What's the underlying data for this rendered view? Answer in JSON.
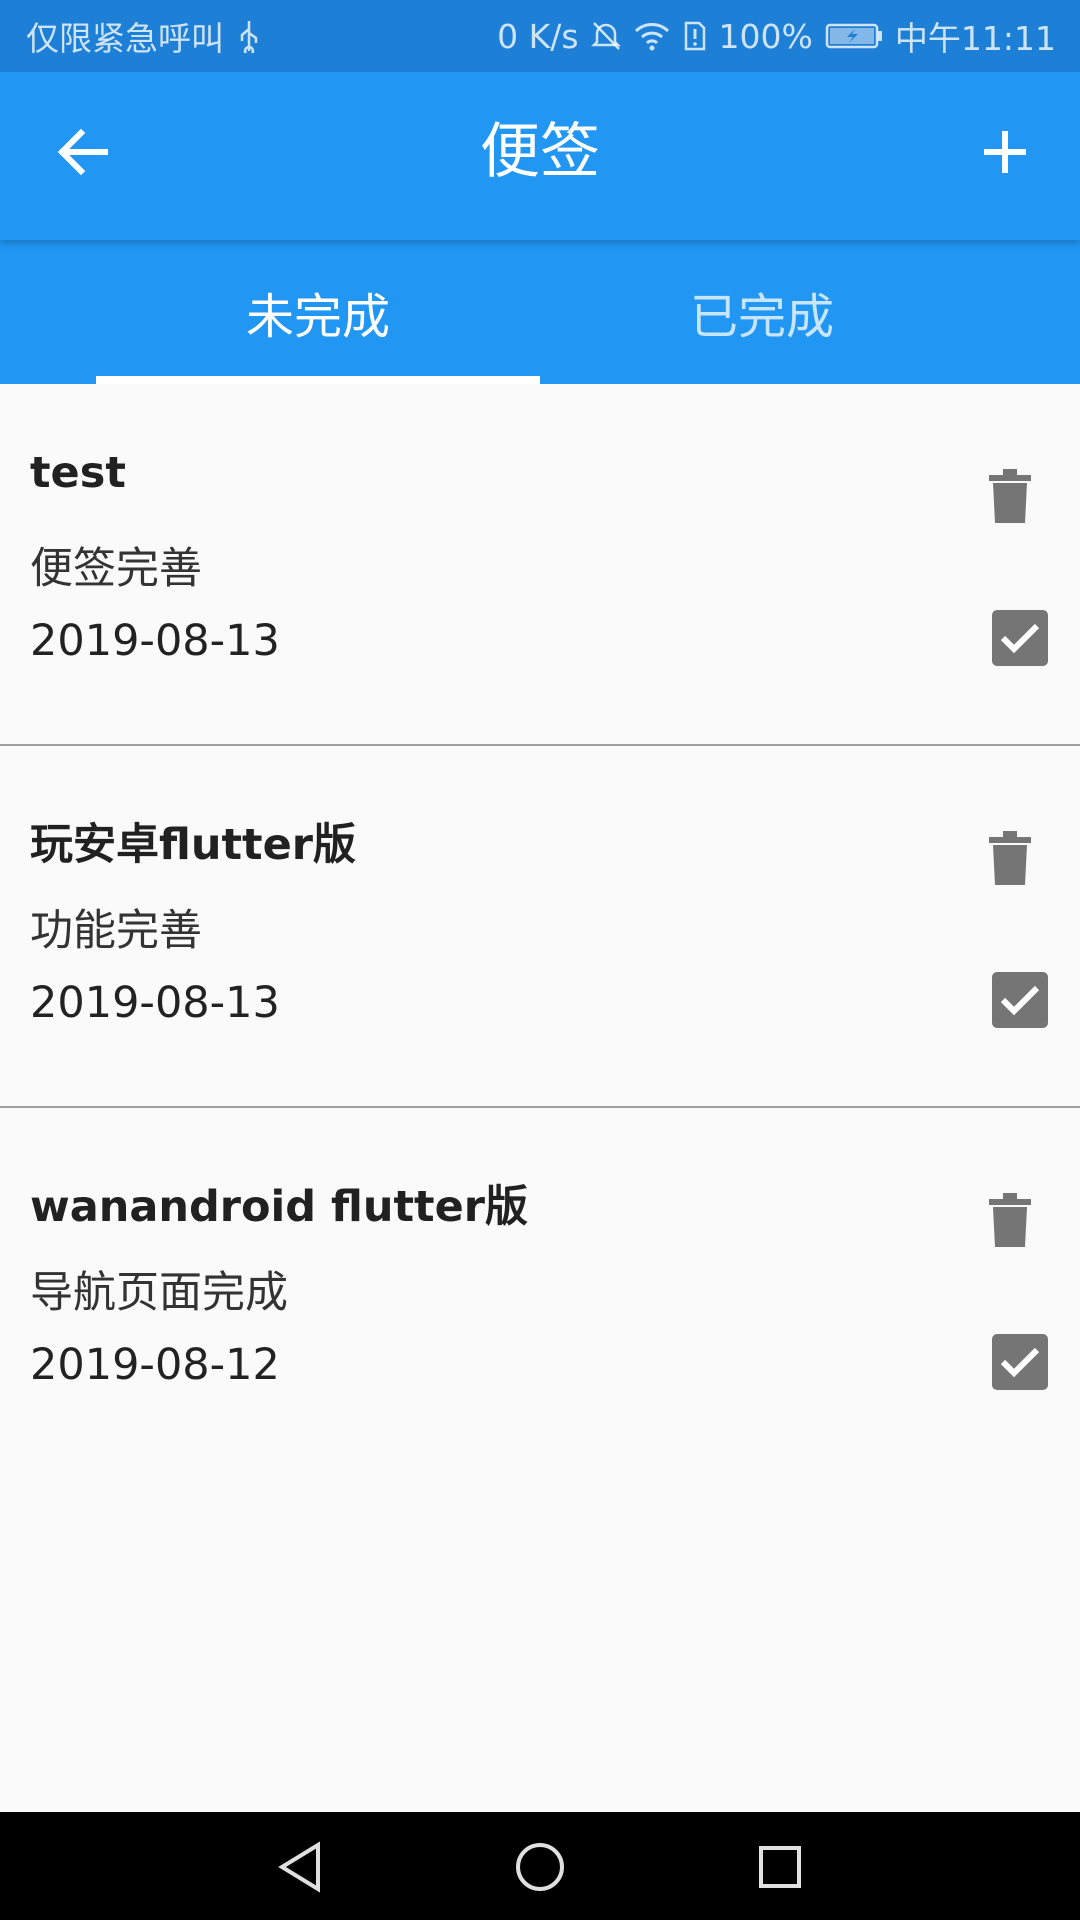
{
  "status_bar": {
    "carrier": "仅限紧急呼叫",
    "speed": "0 K/s",
    "battery": "100%",
    "time": "中午11:11"
  },
  "app_bar": {
    "title": "便签",
    "back_icon": "arrow-left-icon",
    "add_icon": "plus-icon"
  },
  "tabs": [
    {
      "label": "未完成",
      "active": true
    },
    {
      "label": "已完成",
      "active": false
    }
  ],
  "notes": [
    {
      "title": "test",
      "content": "便签完善",
      "date": "2019-08-13",
      "done": true
    },
    {
      "title": "玩安卓flutter版",
      "content": "功能完善",
      "date": "2019-08-13",
      "done": true
    },
    {
      "title": "wanandroid flutter版",
      "content": "导航页面完成",
      "date": "2019-08-12",
      "done": true
    }
  ],
  "colors": {
    "primary": "#2196f3",
    "status_bar": "#1e7fd6",
    "icon_grey": "#757575"
  }
}
